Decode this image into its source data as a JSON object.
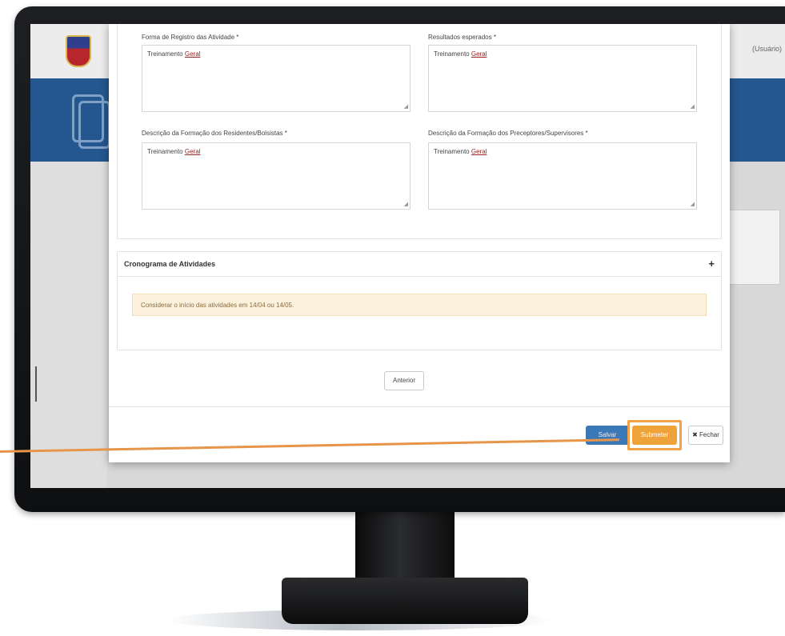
{
  "colors": {
    "accent_orange": "#f2a34a",
    "save_blue": "#3a78b8",
    "banner_blue": "#24578f",
    "alert_bg": "#fcf1dc"
  },
  "header": {
    "user_text": "(Usuário)",
    "logo_icon": "university-crest-icon"
  },
  "fields": [
    {
      "label": "Forma de Registro das Atividade *",
      "value": "Treinamento",
      "value_link": "Geral"
    },
    {
      "label": "Resultados esperados *",
      "value": "Treinamento",
      "value_link": "Geral"
    },
    {
      "label": "Descrição da Formação dos Residentes/Bolsistas *",
      "value": "Treinamento",
      "value_link": "Geral"
    },
    {
      "label": "Descrição da Formação dos Preceptores/Supervisores *",
      "value": "Treinamento",
      "value_link": "Geral"
    }
  ],
  "cronograma": {
    "title": "Cronograma de Atividades",
    "expand_icon": "+",
    "alert": "Considerar o início das atividades em 14/04 ou 14/05."
  },
  "buttons": {
    "previous": "Anterior",
    "save": "Salvar",
    "submit": "Submeter",
    "close": "Fechar",
    "close_icon": "✖"
  }
}
